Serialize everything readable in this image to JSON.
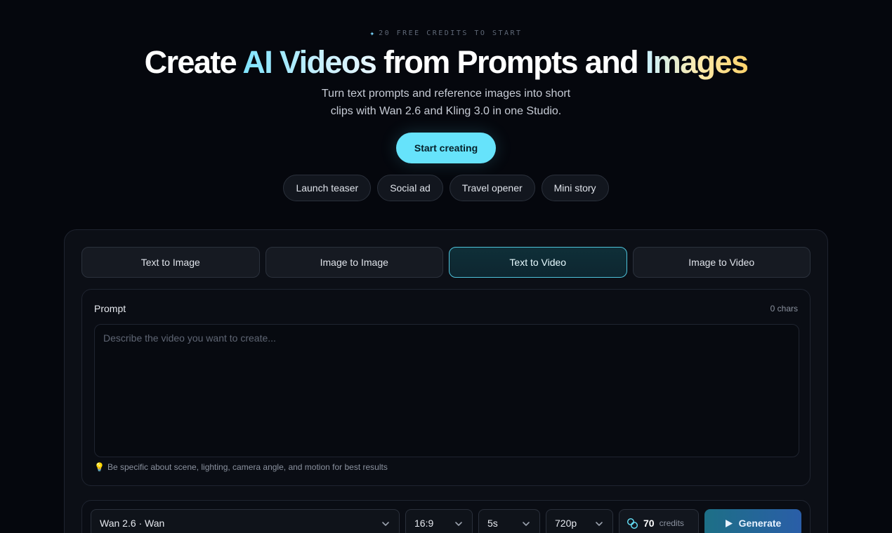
{
  "hero": {
    "badge": "20 FREE CREDITS TO START",
    "title_part1": "Create ",
    "title_highlight1": "AI Videos",
    "title_part2": " from Prompts and ",
    "title_highlight2": "Images",
    "subtitle_line1": "Turn text prompts and reference images into short",
    "subtitle_line2": "clips with Wan 2.6 and Kling 3.0 in one Studio.",
    "cta_label": "Start creating"
  },
  "chips": [
    "Launch teaser",
    "Social ad",
    "Travel opener",
    "Mini story"
  ],
  "tabs": [
    {
      "label": "Text to Image",
      "active": false
    },
    {
      "label": "Image to Image",
      "active": false
    },
    {
      "label": "Text to Video",
      "active": true
    },
    {
      "label": "Image to Video",
      "active": false
    }
  ],
  "prompt": {
    "label": "Prompt",
    "count": "0 chars",
    "placeholder": "Describe the video you want to create...",
    "value": "",
    "tip": "Be specific about scene, lighting, camera angle, and motion for best results"
  },
  "controls": {
    "model": "Wan 2.6 · Wan",
    "aspect": "16:9",
    "duration": "5s",
    "resolution": "720p",
    "credits_value": "70",
    "credits_label": "credits",
    "generate_label": "Generate"
  },
  "colors": {
    "accent": "#66e3fb",
    "background": "#05070d",
    "active_tab_border": "#4fc4dc"
  },
  "icons": {
    "badge": "sparkle-icon",
    "tip": "lightbulb-icon",
    "select": "chevron-down-icon",
    "credits": "coins-icon",
    "generate": "play-icon"
  }
}
